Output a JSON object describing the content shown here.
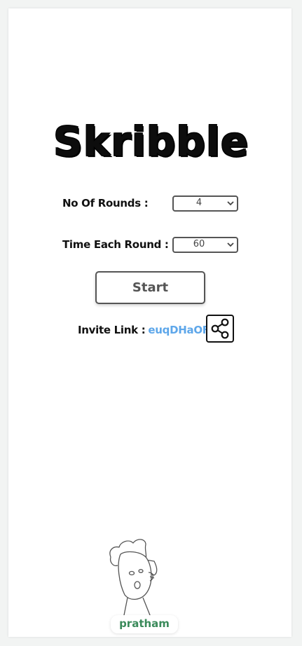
{
  "app": {
    "title": "Skribble"
  },
  "settings": {
    "rounds": {
      "label": "No Of Rounds :",
      "value": "4"
    },
    "time": {
      "label": "Time Each Round :",
      "value": "60"
    }
  },
  "start_button": {
    "label": "Start"
  },
  "invite": {
    "label": "Invite Link :",
    "code": "euqDHaOF"
  },
  "player": {
    "name": "pratham"
  },
  "icons": {
    "share": "share-icon",
    "rounds_dropdown": "chevron-down-icon",
    "time_dropdown": "chevron-down-icon",
    "avatar": "avatar-drawing"
  },
  "colors": {
    "invite_code": "#5ea7ea",
    "player_name": "#3a8a5a",
    "title": "#0d0d0d"
  }
}
